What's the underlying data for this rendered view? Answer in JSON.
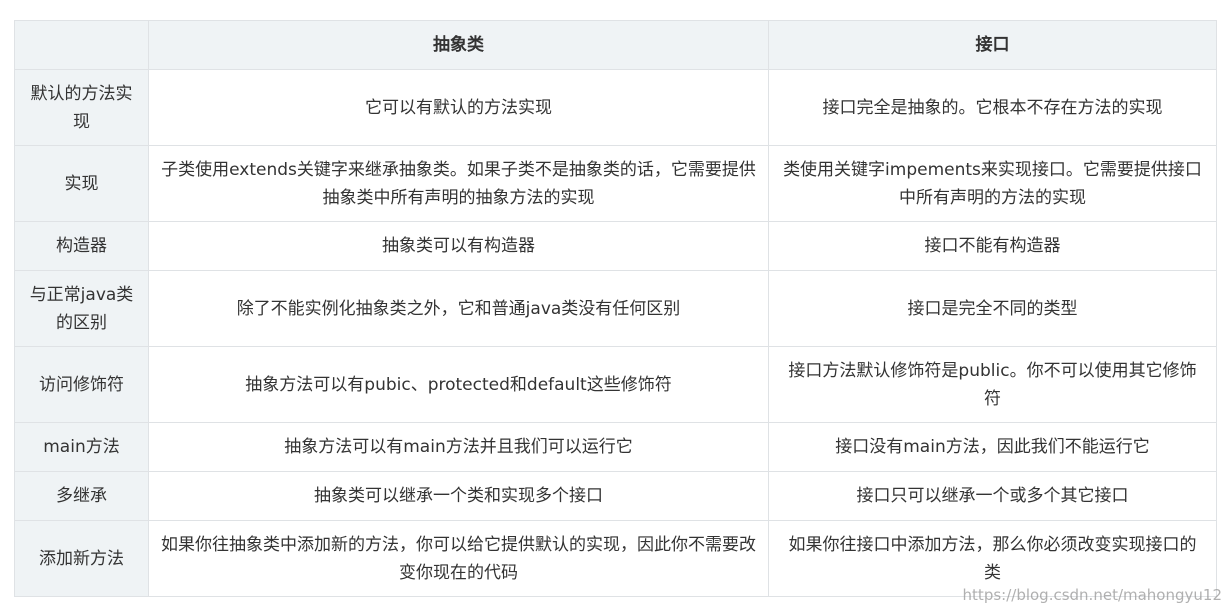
{
  "table": {
    "headers": [
      "",
      "抽象类",
      "接口"
    ],
    "rows": [
      {
        "label": "默认的方法实现",
        "abstract": "它可以有默认的方法实现",
        "interface": "接口完全是抽象的。它根本不存在方法的实现"
      },
      {
        "label": "实现",
        "abstract": "子类使用extends关键字来继承抽象类。如果子类不是抽象类的话，它需要提供抽象类中所有声明的抽象方法的实现",
        "interface": "类使用关键字impements来实现接口。它需要提供接口中所有声明的方法的实现"
      },
      {
        "label": "构造器",
        "abstract": "抽象类可以有构造器",
        "interface": "接口不能有构造器"
      },
      {
        "label": "与正常java类的区别",
        "abstract": "除了不能实例化抽象类之外，它和普通java类没有任何区别",
        "interface": "接口是完全不同的类型"
      },
      {
        "label": "访问修饰符",
        "abstract": "抽象方法可以有pubic、protected和default这些修饰符",
        "interface": "接口方法默认修饰符是public。你不可以使用其它修饰符"
      },
      {
        "label": "main方法",
        "abstract": "抽象方法可以有main方法并且我们可以运行它",
        "interface": "接口没有main方法，因此我们不能运行它"
      },
      {
        "label": "多继承",
        "abstract": "抽象类可以继承一个类和实现多个接口",
        "interface": "接口只可以继承一个或多个其它接口"
      },
      {
        "label": "添加新方法",
        "abstract": "如果你往抽象类中添加新的方法，你可以给它提供默认的实现，因此你不需要改变你现在的代码",
        "interface": "如果你往接口中添加方法，那么你必须改变实现接口的类"
      }
    ]
  },
  "watermark": "https://blog.csdn.net/mahongyu12"
}
